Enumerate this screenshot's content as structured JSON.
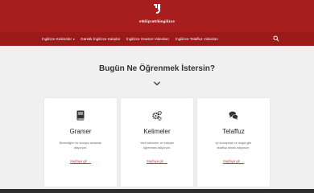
{
  "brand": {
    "name": "etkiliprattikingilizce",
    "color": "#a81e1e"
  },
  "nav": {
    "items": [
      {
        "label": "İngilizce Kelimeler",
        "has_dropdown": true
      },
      {
        "label": "Günlük İngilizce Kalıplar",
        "has_dropdown": false
      },
      {
        "label": "İngilizce Gramer Videoları",
        "has_dropdown": false
      },
      {
        "label": "İngilizce Telaffuz Videoları",
        "has_dropdown": false
      }
    ],
    "search_icon": "search-icon"
  },
  "hero": {
    "title": "Bugün Ne Öğrenmek İstersin?",
    "chevron_icon": "chevron-down-icon"
  },
  "cards": [
    {
      "icon": "book-icon",
      "title": "Gramer",
      "description": "Bilmediğim bir konuyu anlamak istiyorum.",
      "link": "Sayfaya git →"
    },
    {
      "icon": "gears-icon",
      "title": "Kelimeler",
      "description": "Yeni kelimeler ve kalıplar öğrenmek istiyorum.",
      "link": "Sayfaya git →"
    },
    {
      "icon": "chat-icon",
      "title": "Telaffuz",
      "description": "İyi konuşmak ve doğal gibi telaffuz etmek istiyorum.",
      "link": "Sayfaya git →"
    }
  ]
}
